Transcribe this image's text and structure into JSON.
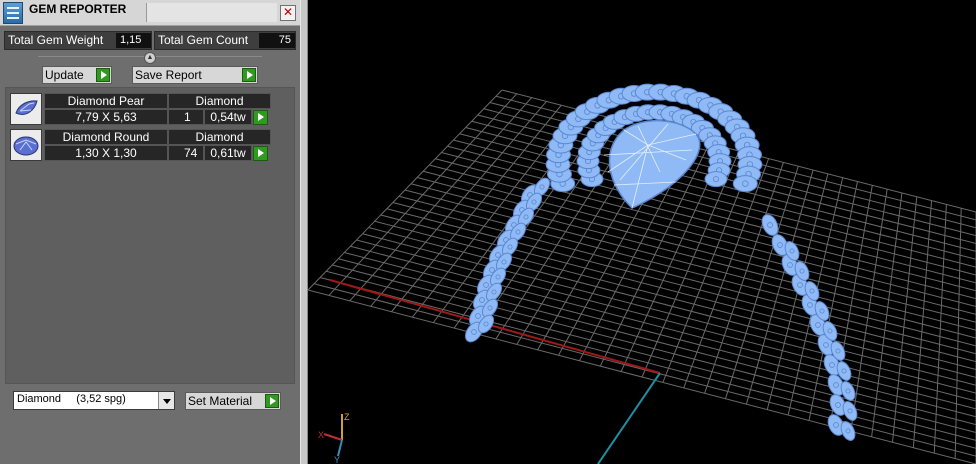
{
  "window": {
    "title": "GEM REPORTER",
    "close_glyph": "✕"
  },
  "stats": {
    "weight_label": "Total Gem Weight",
    "weight_value": "1,15",
    "count_label": "Total Gem Count",
    "count_value": "75"
  },
  "actions": {
    "update_label": "Update",
    "save_label": "Save Report"
  },
  "gems": [
    {
      "name": "Diamond Pear",
      "material": "Diamond",
      "size": "7,79 X 5,63",
      "qty": "1",
      "weight": "0,54tw",
      "shape": "pear"
    },
    {
      "name": "Diamond Round",
      "material": "Diamond",
      "size": "1,30 X 1,30",
      "qty": "74",
      "weight": "0,61tw",
      "shape": "round"
    }
  ],
  "material_select": {
    "value": "Diamond     (3,52 spg)"
  },
  "set_material_label": "Set Material",
  "viewport": {
    "axis_labels": {
      "z": "Z",
      "x": "X",
      "y": "Y"
    },
    "colors": {
      "gem": "#8fbaf5",
      "gem_edge": "#5a87d0",
      "grid": "#6a6a6a",
      "x_axis": "#a01818",
      "y_axis": "#1f8fa0",
      "background": "#000000"
    }
  },
  "icons": [
    "app-icon",
    "close-icon",
    "collapse-icon",
    "play-icon",
    "pear-gem-icon",
    "round-gem-icon",
    "dropdown-arrow-icon",
    "axis-gizmo-icon"
  ]
}
